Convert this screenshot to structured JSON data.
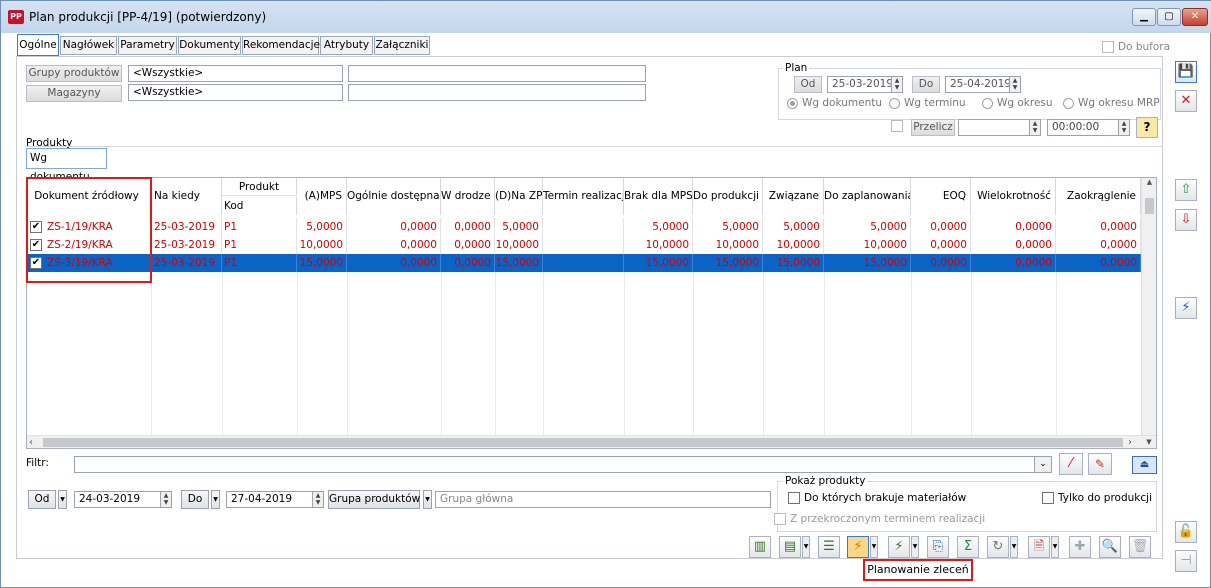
{
  "window": {
    "title": "Plan produkcji [PP-4/19]  (potwierdzony)",
    "icon_text": "PP"
  },
  "tabs": [
    "Ogólne",
    "Nagłówek",
    "Parametry",
    "Dokumenty",
    "Rekomendacje",
    "Atrybuty",
    "Załączniki"
  ],
  "do_bufora": "Do bufora",
  "filters": {
    "grupy_produktow_label": "Grupy produktów",
    "grupy_produktow_value": "<Wszystkie>",
    "magazyny_label": "Magazyny",
    "magazyny_value": "<Wszystkie>"
  },
  "plan": {
    "legend": "Plan",
    "od_label": "Od",
    "od_value": "25-03-2019",
    "do_label": "Do",
    "do_value": "25-04-2019",
    "radios": [
      "Wg dokumentu",
      "Wg terminu",
      "Wg okresu",
      "Wg okresu MRP"
    ],
    "przelicz_label": "Przelicz",
    "time_value": "00:00:00"
  },
  "products": {
    "legend": "Produkty",
    "tab": "Wg dokumentu"
  },
  "grid": {
    "columns": [
      "Dokument źródłowy",
      "Na kiedy",
      "Produkt",
      "Kod",
      "(A)MPS",
      "Ogólnie dostępna",
      "W drodze",
      "(D)Na ZP",
      "Termin realizacji",
      "Brak dla MPS",
      "Do produkcji",
      "Związane",
      "Do zaplanowania",
      "EOQ",
      "Wielokrotność",
      "Zaokrąglenie"
    ],
    "rows": [
      {
        "checked": "✔",
        "doc": "ZS-1/19/KRA",
        "date": "25-03-2019",
        "kod": "P1",
        "mps": "5,0000",
        "dost": "0,0000",
        "drodze": "0,0000",
        "zp": "5,0000",
        "termin": "",
        "brak": "5,0000",
        "doprod": "5,0000",
        "zwiazane": "5,0000",
        "dozapl": "5,0000",
        "eoq": "0,0000",
        "wielo": "0,0000",
        "zaokr": "0,0000"
      },
      {
        "checked": "✔",
        "doc": "ZS-2/19/KRA",
        "date": "25-03-2019",
        "kod": "P1",
        "mps": "10,0000",
        "dost": "0,0000",
        "drodze": "0,0000",
        "zp": "10,0000",
        "termin": "",
        "brak": "10,0000",
        "doprod": "10,0000",
        "zwiazane": "10,0000",
        "dozapl": "10,0000",
        "eoq": "0,0000",
        "wielo": "0,0000",
        "zaokr": "0,0000"
      },
      {
        "checked": "✔",
        "doc": "ZS-3/19/KRA",
        "date": "25-03-2019",
        "kod": "P1",
        "mps": "15,0000",
        "dost": "0,0000",
        "drodze": "0,0000",
        "zp": "15,0000",
        "termin": "",
        "brak": "15,0000",
        "doprod": "15,0000",
        "zwiazane": "15,0000",
        "dozapl": "15,0000",
        "eoq": "0,0000",
        "wielo": "0,0000",
        "zaokr": "0,0000"
      }
    ]
  },
  "filtr_label": "Filtr:",
  "bottom": {
    "od_label": "Od",
    "od_value": "24-03-2019",
    "do_label": "Do",
    "do_value": "27-04-2019",
    "grupa_button": "Grupa produktów",
    "grupa_value": "Grupa główna",
    "pokaz_legend": "Pokaż produkty",
    "opt1": "Do których brakuje materiałów",
    "opt2": "Tylko do produkcji",
    "opt3": "Z przekroczonym terminem realizacji"
  },
  "tooltip": "Planowanie zleceń",
  "colors": {
    "selection": "#0a64c6",
    "row_text": "#d40000",
    "highlight_box": "#e01818"
  }
}
